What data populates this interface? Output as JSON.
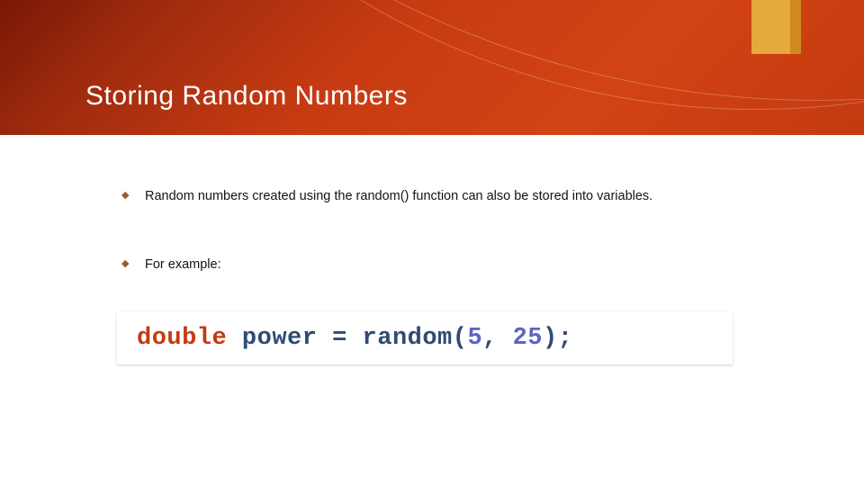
{
  "header": {
    "title": "Storing Random Numbers"
  },
  "bullets": [
    "Random numbers created using the random() function can also be stored into variables.",
    "For example:"
  ],
  "code": {
    "type_keyword": "double",
    "identifier": "power",
    "equals": "=",
    "call_name": "random",
    "paren_open": "(",
    "arg1": "5",
    "comma_sp": ", ",
    "arg2": "25",
    "paren_close": ")",
    "semicolon": ";"
  }
}
